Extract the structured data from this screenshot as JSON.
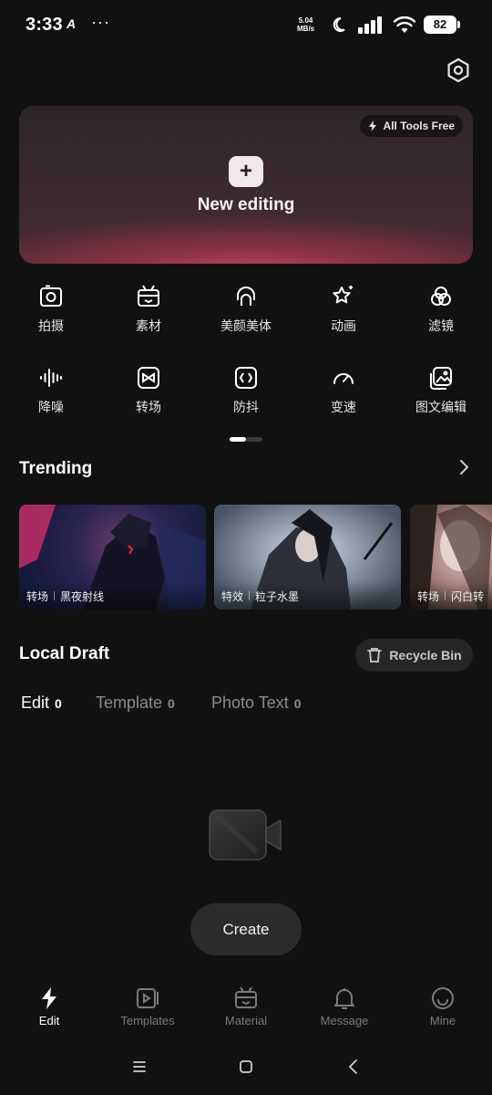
{
  "status_bar": {
    "time": "3:33",
    "app_indicator": "A",
    "more": "···",
    "speed_value": "5.04",
    "speed_unit": "MB/s",
    "battery": "82",
    "icons": [
      "moon-icon",
      "signal-icon",
      "wifi-icon",
      "battery-icon"
    ]
  },
  "header": {
    "settings_icon": "gear-icon"
  },
  "hero": {
    "badge": "All Tools Free",
    "badge_icon": "lightning-icon",
    "plus": "+",
    "title": "New editing"
  },
  "tools": [
    {
      "label": "拍摄",
      "icon": "camera-icon"
    },
    {
      "label": "素材",
      "icon": "material-box-icon"
    },
    {
      "label": "美颜美体",
      "icon": "face-icon"
    },
    {
      "label": "动画",
      "icon": "star-sparkle-icon"
    },
    {
      "label": "滤镜",
      "icon": "filter-circles-icon"
    },
    {
      "label": "降噪",
      "icon": "waveform-icon"
    },
    {
      "label": "转场",
      "icon": "transition-icon"
    },
    {
      "label": "防抖",
      "icon": "stabilize-icon"
    },
    {
      "label": "变速",
      "icon": "speedometer-icon"
    },
    {
      "label": "图文编辑",
      "icon": "image-edit-icon"
    }
  ],
  "pager": {
    "pages": 2,
    "active": 1
  },
  "trending": {
    "title": "Trending",
    "cards": [
      {
        "tag": "转场",
        "name": "黑夜射线"
      },
      {
        "tag": "特效",
        "name": "粒子水墨"
      },
      {
        "tag": "转场",
        "name": "闪白转"
      }
    ]
  },
  "local_draft": {
    "title": "Local Draft",
    "recycle_label": "Recycle Bin",
    "tabs": [
      {
        "label": "Edit",
        "count": "0",
        "active": true
      },
      {
        "label": "Template",
        "count": "0",
        "active": false
      },
      {
        "label": "Photo Text",
        "count": "0",
        "active": false
      }
    ],
    "empty_icon": "video-camera-icon",
    "create_label": "Create"
  },
  "bottom_nav": [
    {
      "label": "Edit",
      "icon": "lightning-icon",
      "active": true
    },
    {
      "label": "Templates",
      "icon": "play-template-icon",
      "active": false
    },
    {
      "label": "Material",
      "icon": "material-box-icon",
      "active": false
    },
    {
      "label": "Message",
      "icon": "bell-icon",
      "active": false
    },
    {
      "label": "Mine",
      "icon": "smile-icon",
      "active": false
    }
  ],
  "colors": {
    "background": "#111111",
    "hero_accent": "#c84c61",
    "text_primary": "#ffffff",
    "text_muted": "#8c8c8c"
  }
}
